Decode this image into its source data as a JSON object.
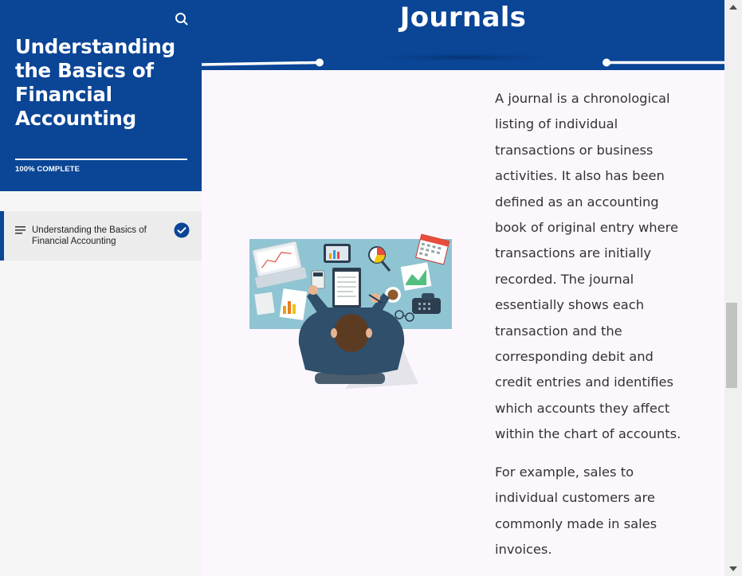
{
  "sidebar": {
    "course_title": "Understanding the Basics of Financial Accounting",
    "progress_label": "100% COMPLETE",
    "progress_fraction": 1.0,
    "lessons": [
      {
        "label": "Understanding the Basics of Financial Accounting",
        "completed": true
      }
    ]
  },
  "main": {
    "heading": "Journals",
    "paragraphs": [
      "A journal is a chronological listing of individual transactions or business activities. It also has been defined as an accounting book of original entry where transactions are initially recorded. The journal essentially shows each transaction and the corresponding debit and credit entries and identifies which accounts they affect within the chart of accounts.",
      "For example, sales to individual customers are commonly made in sales invoices."
    ]
  },
  "colors": {
    "brand_blue": "#0a4596",
    "content_bg": "#fcf7fd",
    "sidebar_bg": "#f6f6f6"
  },
  "icons": {
    "search": "search-icon",
    "menu": "menu-lines-icon",
    "check": "check-circle-icon",
    "scroll_up": "triangle-up-icon",
    "scroll_down": "triangle-down-icon"
  }
}
